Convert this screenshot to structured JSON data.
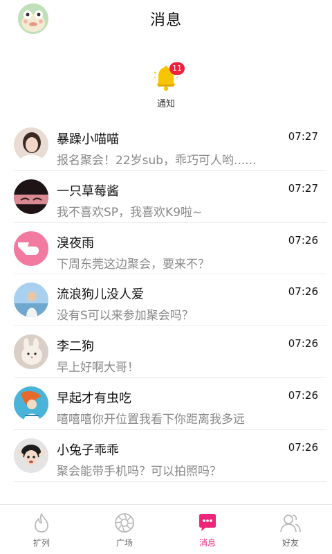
{
  "header": {
    "title": "消息"
  },
  "notification": {
    "label": "通知",
    "badge": "11"
  },
  "messages": [
    {
      "name": "暴躁小喵喵",
      "time": "07:27",
      "text": "报名聚会！22岁sub，乖巧可人哟......"
    },
    {
      "name": "一只草莓酱",
      "time": "07:27",
      "text": "我不喜欢SP，我喜欢K9啦~"
    },
    {
      "name": "溴夜雨",
      "time": "07:26",
      "text": "下周东莞这边聚会，要来不？"
    },
    {
      "name": "流浪狗儿没人爱",
      "time": "07:26",
      "text": "没有S可以来参加聚会吗？"
    },
    {
      "name": "李二狗",
      "time": "07:26",
      "text": "早上好啊大哥！"
    },
    {
      "name": "早起才有虫吃",
      "time": "07:26",
      "text": "嘻嘻嘻你开位置我看下你距离我多远"
    },
    {
      "name": "小兔子乖乖",
      "time": "07:26",
      "text": "聚会能带手机吗？可以拍照吗？"
    }
  ],
  "tabs": [
    {
      "label": "扩列",
      "icon": "flame-icon",
      "active": false
    },
    {
      "label": "广场",
      "icon": "aperture-icon",
      "active": false
    },
    {
      "label": "消息",
      "icon": "chat-bubble-icon",
      "active": true
    },
    {
      "label": "好友",
      "icon": "friends-icon",
      "active": false
    }
  ],
  "colors": {
    "accent": "#f0257a",
    "badge": "#f0203c",
    "bell": "#f7c400"
  }
}
